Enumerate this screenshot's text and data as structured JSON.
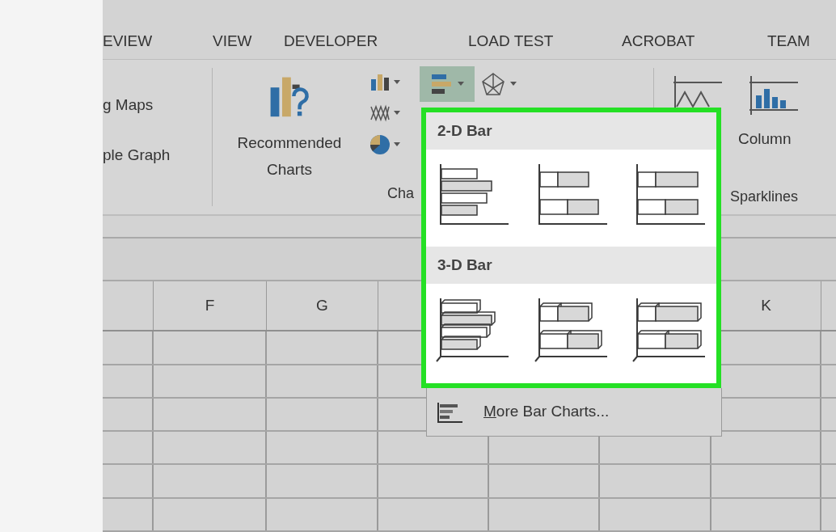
{
  "tabs": [
    {
      "label": "EVIEW",
      "selected": false
    },
    {
      "label": "VIEW",
      "selected": false
    },
    {
      "label": "DEVELOPER",
      "selected": false
    },
    {
      "label": "LOAD TEST",
      "selected": false
    },
    {
      "label": "ACROBAT",
      "selected": false
    },
    {
      "label": "TEAM",
      "selected": false
    }
  ],
  "ribbon": {
    "maps_group": [
      "g Maps",
      "ple Graph"
    ],
    "recommended": [
      "Recommended",
      "Charts"
    ],
    "bar_chart_button": {
      "expanded": true
    },
    "charts_label": "Cha",
    "sparklines": {
      "column": "Column",
      "label": "Sparklines"
    }
  },
  "dropdown": {
    "sections": [
      {
        "title": "2-D Bar",
        "kind": "flat"
      },
      {
        "title": "3-D Bar",
        "kind": "solid"
      }
    ],
    "more": "More Bar Charts..."
  },
  "sheet": {
    "column_headers": [
      "F",
      "G",
      "K"
    ]
  }
}
